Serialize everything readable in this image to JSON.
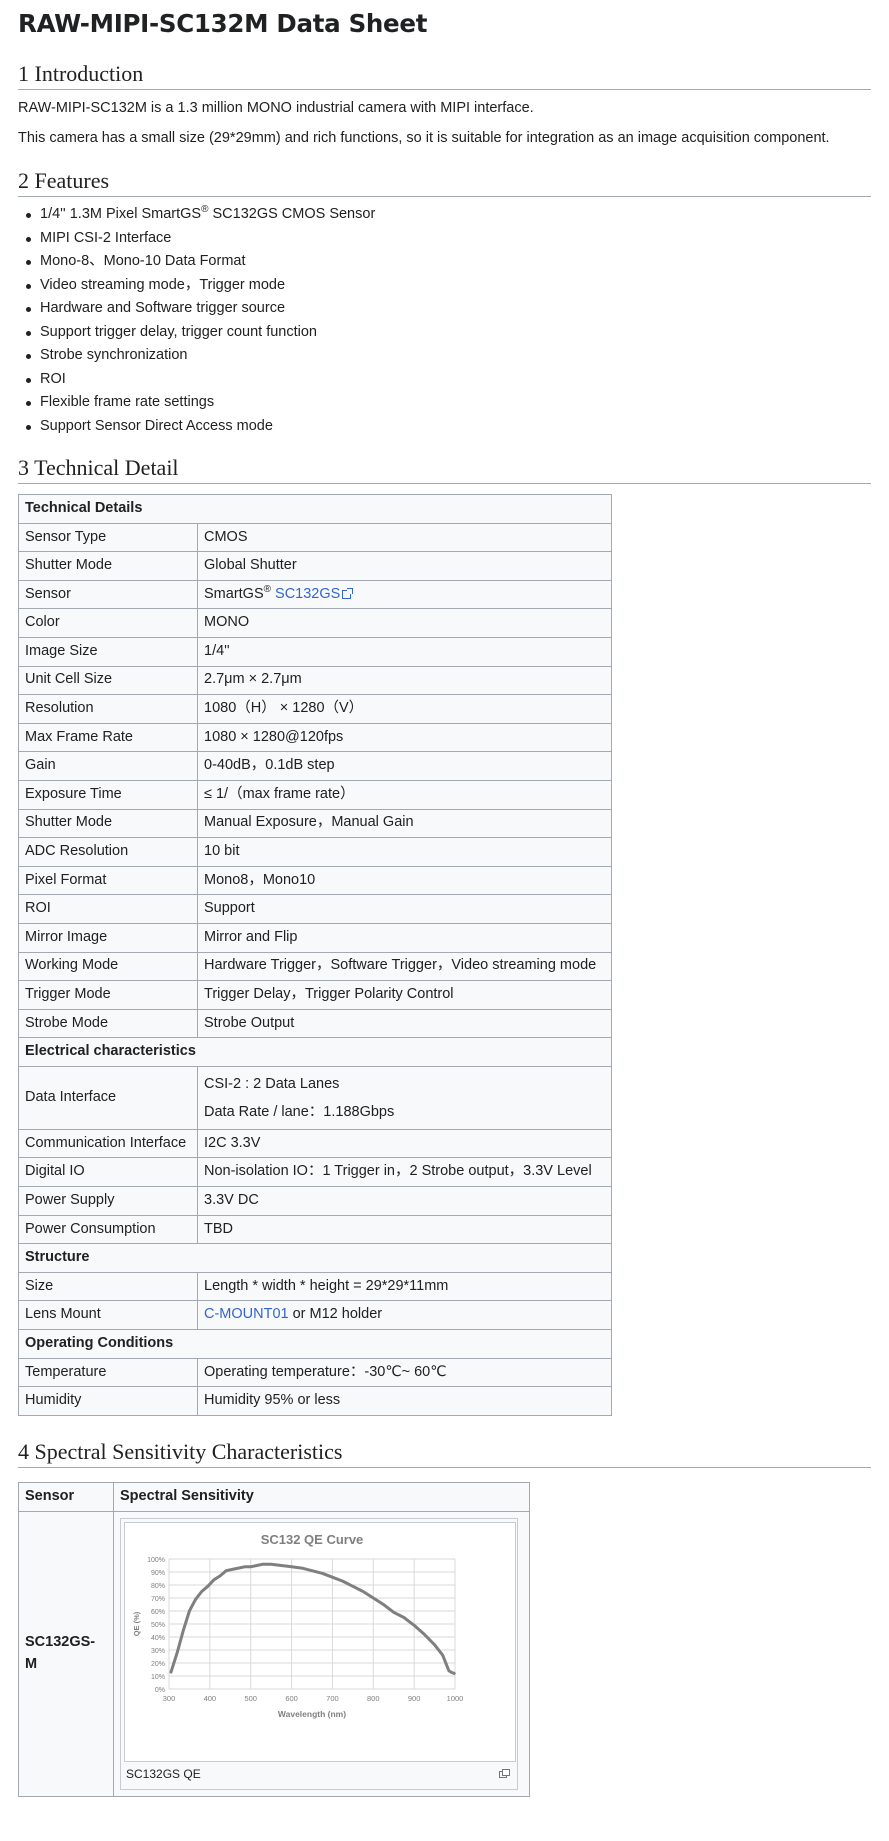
{
  "title": "RAW-MIPI-SC132M Data Sheet",
  "sections": {
    "intro": {
      "heading": "1 Introduction",
      "paragraphs": [
        "RAW-MIPI-SC132M is a 1.3 million MONO industrial camera with MIPI interface.",
        "This camera has a small size (29*29mm) and rich functions, so it is suitable for integration as an image acquisition component."
      ]
    },
    "features": {
      "heading": "2 Features",
      "item0_pre": "1/4'' 1.3M Pixel SmartGS",
      "item0_sup": "®",
      "item0_post": " SC132GS CMOS Sensor",
      "items": [
        "MIPI CSI-2 Interface",
        "Mono-8、Mono-10 Data Format",
        "Video streaming mode，Trigger mode",
        "Hardware and Software trigger source",
        "Support trigger delay, trigger count function",
        "Strobe synchronization",
        "ROI",
        "Flexible frame rate settings",
        "Support Sensor Direct Access mode"
      ]
    },
    "tech": {
      "heading": "3 Technical Detail",
      "group_technical": "Technical Details",
      "group_electrical": "Electrical characteristics",
      "group_structure": "Structure",
      "group_operating": "Operating Conditions",
      "rows": {
        "sensor_type": [
          "Sensor Type",
          "CMOS"
        ],
        "shutter_mode": [
          "Shutter Mode",
          "Global Shutter"
        ],
        "sensor_label": "Sensor",
        "sensor_pre": "SmartGS",
        "sensor_sup": "®",
        "sensor_link": "SC132GS",
        "color": [
          "Color",
          "MONO"
        ],
        "image_size": [
          "Image Size",
          "1/4''"
        ],
        "unit_cell": [
          "Unit Cell Size",
          "2.7μm × 2.7μm"
        ],
        "resolution": [
          "Resolution",
          "1080（H） × 1280（V）"
        ],
        "max_frame_rate": [
          "Max Frame Rate",
          "1080 × 1280@120fps"
        ],
        "gain": [
          "Gain",
          "0-40dB，0.1dB step"
        ],
        "exposure": [
          "Exposure Time",
          "≤ 1/（max frame rate）"
        ],
        "shutter_mode2": [
          "Shutter Mode",
          "Manual Exposure，Manual Gain"
        ],
        "adc": [
          "ADC Resolution",
          "10 bit"
        ],
        "pixel_format": [
          "Pixel Format",
          "Mono8，Mono10"
        ],
        "roi": [
          "ROI",
          "Support"
        ],
        "mirror": [
          "Mirror Image",
          "Mirror and Flip"
        ],
        "working_mode": [
          "Working Mode",
          "Hardware Trigger，Software Trigger，Video streaming mode"
        ],
        "trigger_mode": [
          "Trigger Mode",
          "Trigger Delay，Trigger Polarity Control"
        ],
        "strobe_mode": [
          "Strobe Mode",
          "Strobe Output"
        ],
        "data_interface_label": "Data Interface",
        "data_interface_line1": "CSI-2 : 2 Data Lanes",
        "data_interface_line2": "Data Rate / lane：1.188Gbps",
        "comm": [
          "Communication Interface",
          "I2C 3.3V"
        ],
        "digital_io": [
          "Digital IO",
          "Non-isolation IO：1 Trigger in，2 Strobe output，3.3V Level"
        ],
        "power_supply": [
          "Power Supply",
          "3.3V DC"
        ],
        "power_consumption": [
          "Power Consumption",
          "TBD"
        ],
        "size": [
          "Size",
          "Length * width * height = 29*29*11mm"
        ],
        "lens_mount_label": "Lens Mount",
        "lens_mount_link": "C-MOUNT01",
        "lens_mount_rest": " or M12 holder",
        "temperature": [
          "Temperature",
          "Operating temperature：-30℃~ 60℃"
        ],
        "humidity": [
          "Humidity",
          "Humidity 95% or less"
        ]
      }
    },
    "spectral": {
      "heading": "4 Spectral Sensitivity Characteristics",
      "col_sensor": "Sensor",
      "col_spectral": "Spectral Sensitivity",
      "sensor_name": "SC132GS-M",
      "caption": "SC132GS QE"
    }
  },
  "chart_data": {
    "type": "line",
    "title": "SC132 QE Curve",
    "xlabel": "Wavelength (nm)",
    "ylabel": "QE (%)",
    "xlim": [
      300,
      1000
    ],
    "ylim": [
      0,
      100
    ],
    "x_ticks": [
      "300",
      "400",
      "500",
      "600",
      "700",
      "800",
      "900",
      "1000"
    ],
    "y_ticks": [
      "0%",
      "10%",
      "20%",
      "30%",
      "40%",
      "50%",
      "60%",
      "70%",
      "80%",
      "90%",
      "100%"
    ],
    "grid": true,
    "line_color": "#7f7f7f",
    "x": [
      305,
      320,
      335,
      350,
      365,
      380,
      395,
      410,
      425,
      440,
      455,
      470,
      485,
      500,
      515,
      530,
      550,
      575,
      600,
      625,
      650,
      675,
      700,
      725,
      750,
      775,
      800,
      825,
      850,
      875,
      900,
      925,
      950,
      970,
      980,
      985,
      990,
      998
    ],
    "y": [
      13,
      28,
      45,
      60,
      69,
      75,
      79,
      84,
      87,
      91,
      92,
      93,
      94,
      94,
      95,
      96,
      96,
      95,
      94,
      93,
      91,
      89,
      86,
      83,
      79,
      75,
      70,
      65,
      59,
      55,
      49,
      42,
      34,
      26,
      18,
      14,
      13,
      12
    ]
  }
}
